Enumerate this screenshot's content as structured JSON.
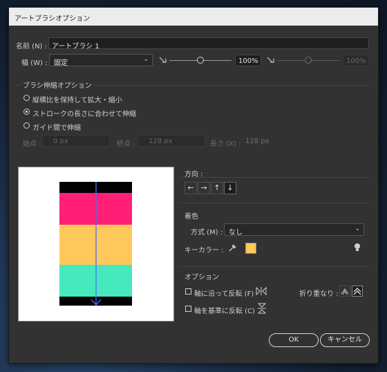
{
  "window": {
    "title": "アートブラシオプション"
  },
  "name": {
    "label": "名前 (N) :",
    "value": "アートブラシ 1"
  },
  "width": {
    "label": "幅 (W) :",
    "mode": "固定",
    "value": "100%",
    "value2": "100%"
  },
  "scale_options": {
    "heading": "ブラシ伸縮オプション",
    "options": [
      "縦横比を保持して拡大・縮小",
      "ストロークの長さに合わせて伸縮",
      "ガイド間で伸縮"
    ],
    "selected_index": 1,
    "start_label": "始点 :",
    "start_value": "0 px",
    "end_label": "終点 :",
    "end_value": "128 px",
    "length_label": "長さ (X) :",
    "length_value": "128 px"
  },
  "direction": {
    "heading": "方向 :",
    "buttons": [
      "←",
      "→",
      "↑",
      "↓"
    ],
    "active_index": 3
  },
  "colorization": {
    "heading": "着色",
    "method_label": "方式 (M) :",
    "method_value": "なし",
    "key_color_label": "キーカラー :",
    "key_color": "#ffc85a"
  },
  "options": {
    "heading": "オプション",
    "flip_along": "軸に沿って反転 (F)",
    "flip_across": "軸を基準に反転 (C)",
    "overlap_label": "折り重なり :"
  },
  "buttons": {
    "ok": "OK",
    "cancel": "キャンセル"
  },
  "preview": {
    "colors": {
      "black": "#000000",
      "pink": "#ff1f77",
      "yellow": "#ffc85a",
      "teal": "#46e8be",
      "arrow": "#4a72ff"
    }
  }
}
